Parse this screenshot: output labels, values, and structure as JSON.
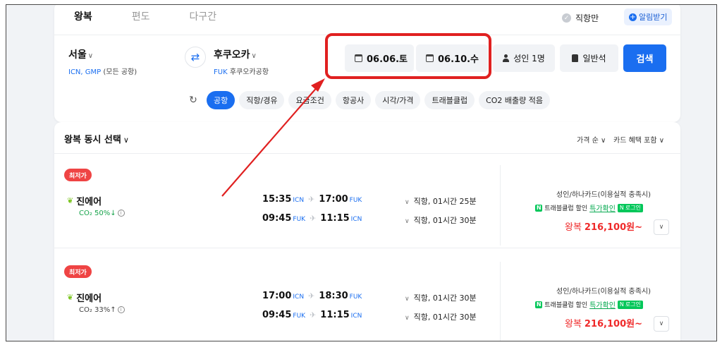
{
  "tabs": [
    "왕복",
    "편도",
    "다구간"
  ],
  "header": {
    "direct_only_label": "직항만",
    "alert_label": "알림받기"
  },
  "route": {
    "origin": {
      "city": "서울",
      "codes": "ICN, GMP",
      "name": "(모든 공항)"
    },
    "destination": {
      "city": "후쿠오카",
      "code": "FUK",
      "name": "후쿠오카공항"
    }
  },
  "dates": {
    "depart": "06.06.토",
    "return": "06.10.수"
  },
  "passengers": "성인 1명",
  "cabin": "일반석",
  "search_label": "검색",
  "filters": [
    "공항",
    "직항/경유",
    "요금조건",
    "항공사",
    "시각/가격",
    "트래블클럽",
    "CO2 배출량 적음"
  ],
  "results": {
    "title": "왕복 동시 선택",
    "sort_price": "가격 순",
    "sort_card": "카드 혜택 포함",
    "items": [
      {
        "badge": "최저가",
        "airline": "진에어",
        "co2": "CO₂ 50%↓",
        "out": {
          "dep_time": "15:35",
          "dep_ap": "ICN",
          "arr_time": "17:00",
          "arr_ap": "FUK",
          "duration": "직항, 01시간 25분"
        },
        "back": {
          "dep_time": "09:45",
          "dep_ap": "FUK",
          "arr_time": "11:15",
          "arr_ap": "ICN",
          "duration": "직항, 01시간 30분"
        },
        "card_offer": "성인/하나카드(이용실적 충족시)",
        "benefit": "트래블클럽 할인",
        "check": "특가확인",
        "login": "로그인",
        "price_prefix": "왕복",
        "price": "216,100원~"
      },
      {
        "badge": "최저가",
        "airline": "진에어",
        "co2": "CO₂ 33%↑",
        "out": {
          "dep_time": "17:00",
          "dep_ap": "ICN",
          "arr_time": "18:30",
          "arr_ap": "FUK",
          "duration": "직항, 01시간 30분"
        },
        "back": {
          "dep_time": "09:45",
          "dep_ap": "FUK",
          "arr_time": "11:15",
          "arr_ap": "ICN",
          "duration": "직항, 01시간 30분"
        },
        "card_offer": "성인/하나카드(이용실적 충족시)",
        "benefit": "트래블클럽 할인",
        "check": "특가확인",
        "login": "로그인",
        "price_prefix": "왕복",
        "price": "216,100원~"
      }
    ]
  },
  "colors": {
    "accent": "#1a6ef0",
    "price": "#ef2a2a",
    "badge": "#ef4444",
    "naver_green": "#03c75a",
    "annotation": "#e02020"
  }
}
